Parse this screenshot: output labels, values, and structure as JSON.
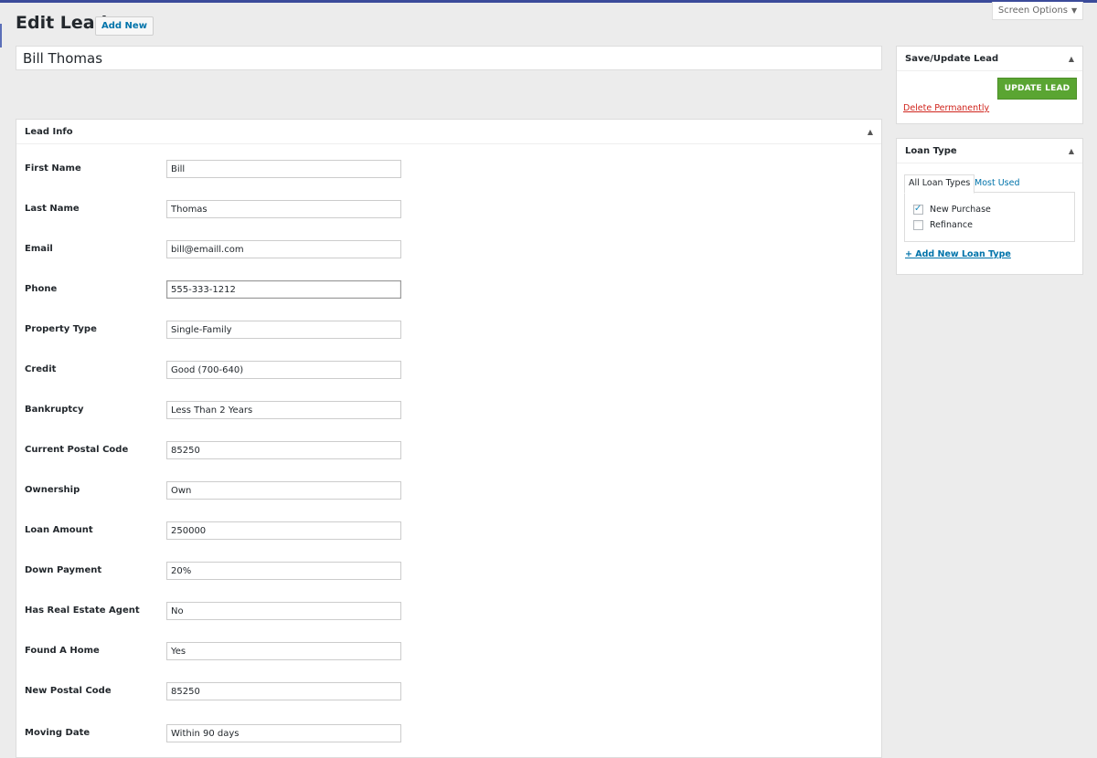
{
  "page": {
    "title": "Edit Lead",
    "add_new_label": "Add New",
    "screen_options_label": "Screen Options"
  },
  "lead_title": "Bill Thomas",
  "lead_info": {
    "heading": "Lead Info",
    "fields": [
      {
        "label": "First Name",
        "value": "Bill"
      },
      {
        "label": "Last Name",
        "value": "Thomas"
      },
      {
        "label": "Email",
        "value": "bill@emaill.com"
      },
      {
        "label": "Phone",
        "value": "555-333-1212"
      },
      {
        "label": "Property Type",
        "value": "Single-Family"
      },
      {
        "label": "Credit",
        "value": "Good (700-640)"
      },
      {
        "label": "Bankruptcy",
        "value": "Less Than 2 Years"
      },
      {
        "label": "Current Postal Code",
        "value": "85250"
      },
      {
        "label": "Ownership",
        "value": "Own"
      },
      {
        "label": "Loan Amount",
        "value": "250000"
      },
      {
        "label": "Down Payment",
        "value": "20%"
      },
      {
        "label": "Has Real Estate Agent",
        "value": "No"
      },
      {
        "label": "Found A Home",
        "value": "Yes"
      },
      {
        "label": "New Postal Code",
        "value": "85250"
      },
      {
        "label": "Moving Date",
        "value": "Within 90 days"
      }
    ]
  },
  "save_box": {
    "heading": "Save/Update Lead",
    "update_label": "UPDATE LEAD",
    "delete_label": "Delete Permanently"
  },
  "loan_type": {
    "heading": "Loan Type",
    "tab_all": "All Loan Types",
    "tab_most_used": "Most Used",
    "options": [
      {
        "label": "New Purchase",
        "checked": true
      },
      {
        "label": "Refinance",
        "checked": false
      }
    ],
    "add_new_label": "+ Add New Loan Type"
  },
  "colors": {
    "accent_bar": "#3b4b9a",
    "update_button": "#5aa532",
    "delete_link": "#d0241c",
    "link": "#0073aa"
  },
  "icons": {
    "toggle": "triangle-up-icon",
    "dropdown": "caret-down-icon",
    "checkbox_check": "checkmark-icon"
  }
}
